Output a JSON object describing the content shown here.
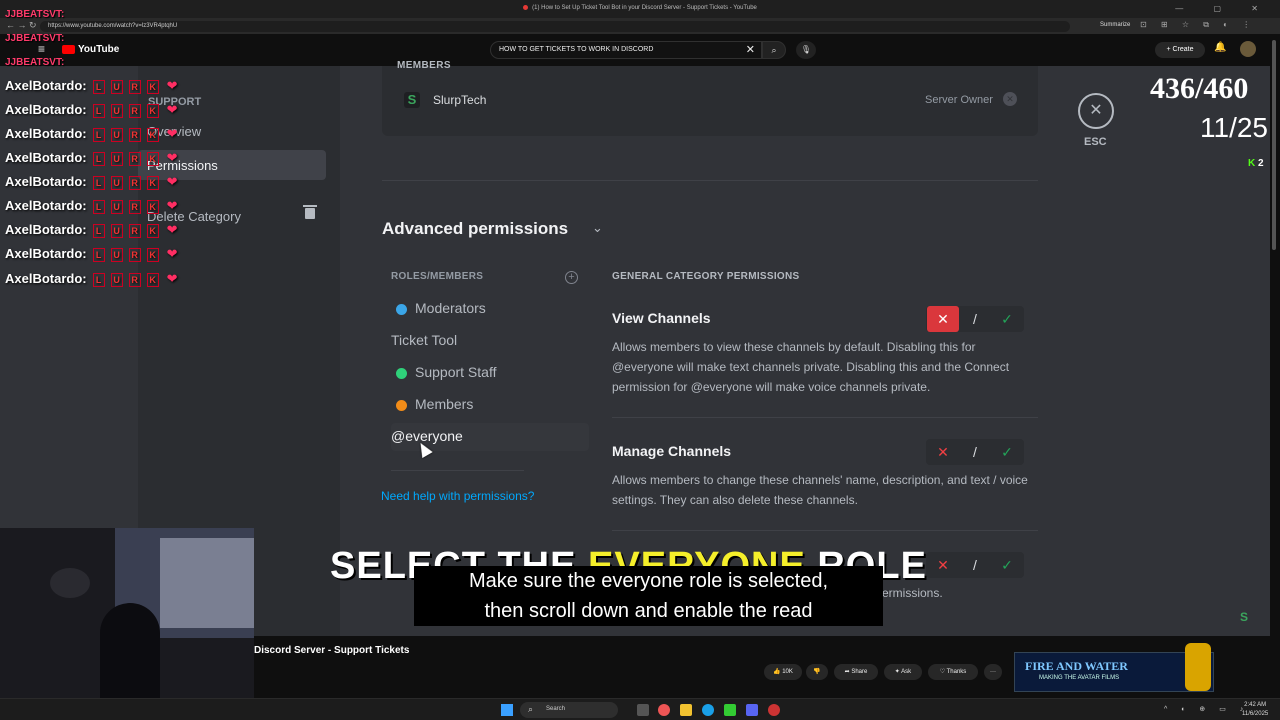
{
  "browser": {
    "tab_title": "(1) How to Set Up Ticket Tool Bot in your Discord Server - Support Tickets - YouTube",
    "url": "https://www.youtube.com/watch?v=lz3VR4ptqhU",
    "summarize_label": "Summarize"
  },
  "youtube": {
    "logo_text": "YouTube",
    "search_value": "HOW TO GET TICKETS TO WORK IN DISCORD",
    "create_label": "+ Create",
    "video_title": "Discord Server - Support Tickets",
    "actions": {
      "like_count": "10K",
      "share_label": "Share",
      "ask_label": "Ask",
      "thanks_label": "Thanks",
      "more_label": "···"
    },
    "ad": {
      "line1": "FIRE AND WATER",
      "line2": "MAKING THE AVATAR FILMS"
    }
  },
  "stream_overlay": {
    "counter_main": "436/460",
    "counter_sub": "11/25",
    "kick_count": "2",
    "chat_top_names": [
      "JJBEATSVT:",
      "JJBEATSVT:",
      "JJBEATSVT:"
    ],
    "chat_lines": [
      {
        "name": "AxelBotardo:"
      },
      {
        "name": "AxelBotardo:"
      },
      {
        "name": "AxelBotardo:"
      },
      {
        "name": "AxelBotardo:"
      },
      {
        "name": "AxelBotardo:"
      },
      {
        "name": "AxelBotardo:"
      },
      {
        "name": "AxelBotardo:"
      },
      {
        "name": "AxelBotardo:"
      },
      {
        "name": "AxelBotardo:"
      }
    ],
    "caption_big": {
      "pre": "SELECT THE ",
      "highlight": "EVERYONE",
      "post": " ROLE"
    },
    "caption_sub": {
      "line1": "Make sure the everyone role is selected,",
      "line2": "then scroll down and enable the read"
    }
  },
  "discord": {
    "sidebar": {
      "header": "SUPPORT",
      "items": [
        {
          "label": "Overview",
          "selected": false
        },
        {
          "label": "Permissions",
          "selected": true
        },
        {
          "label": "Delete Category",
          "selected": false
        }
      ]
    },
    "members": {
      "header": "MEMBERS",
      "entry": {
        "name": "SlurpTech",
        "role": "Server Owner"
      }
    },
    "advanced": {
      "title": "Advanced permissions",
      "roles_header": "ROLES/MEMBERS",
      "roles": [
        {
          "label": "Moderators",
          "color": "#3ba6e8"
        },
        {
          "label": "Ticket Tool",
          "color": ""
        },
        {
          "label": "Support Staff",
          "color": "#2fd17a"
        },
        {
          "label": "Members",
          "color": "#f28c18"
        },
        {
          "label": "@everyone",
          "color": "",
          "selected": true
        }
      ],
      "help_link": "Need help with permissions?",
      "perms_header": "GENERAL CATEGORY PERMISSIONS",
      "permissions": [
        {
          "name": "View Channels",
          "description": "Allows members to view these channels by default. Disabling this for @everyone will make text channels private. Disabling this and the Connect permission for @everyone will make voice channels private.",
          "state": "deny"
        },
        {
          "name": "Manage Channels",
          "description": "Allows members to change these channels' name, description, and text / voice settings. They can also delete these channels.",
          "state": "neutral"
        },
        {
          "name": "",
          "description": "ermissions.",
          "state": "neutral"
        }
      ]
    },
    "esc_label": "ESC"
  },
  "taskbar": {
    "search_label": "Search",
    "time": "2:42 AM",
    "date": "11/6/2025"
  },
  "colors": {
    "deny": "#da373c",
    "allow": "#23a559",
    "link": "#00a8fc",
    "highlight": "#f5ef2a"
  }
}
